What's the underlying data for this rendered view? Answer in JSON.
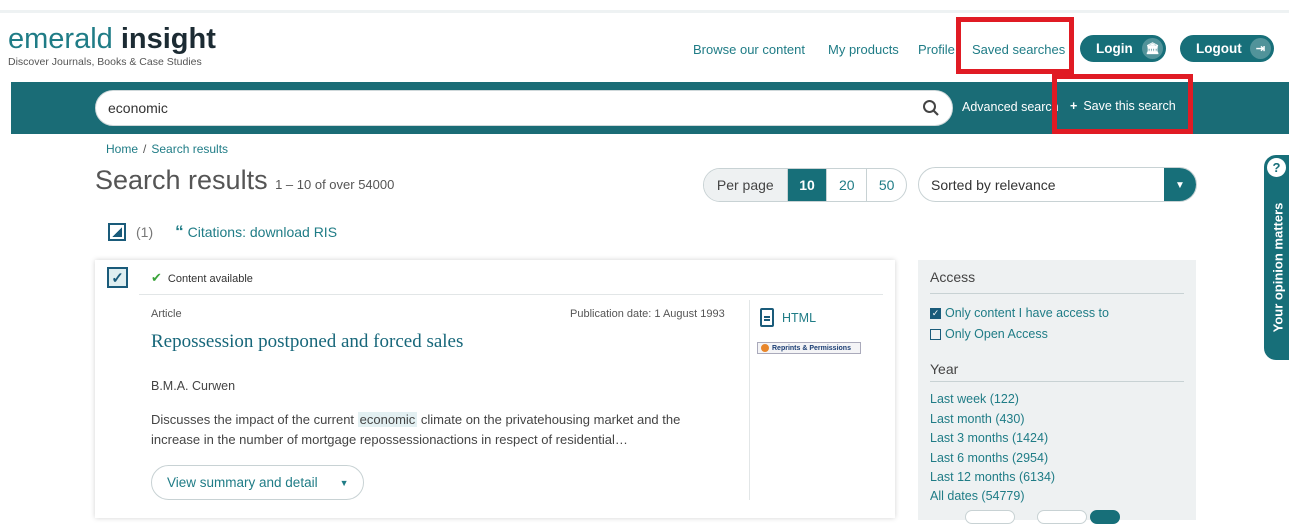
{
  "brand": {
    "name_part1": "emerald",
    "name_part2": "insight",
    "tagline": "Discover Journals, Books & Case Studies"
  },
  "nav": {
    "browse": "Browse our content",
    "products": "My products",
    "profile": "Profile",
    "saved": "Saved searches",
    "login": "Login",
    "logout": "Logout"
  },
  "search": {
    "value": "economic",
    "advanced": "Advanced search",
    "save": "Save this search"
  },
  "breadcrumb": {
    "home": "Home",
    "sep": "/",
    "current": "Search results"
  },
  "results": {
    "title": "Search results",
    "count": "1 – 10 of over 54000"
  },
  "per_page": {
    "label": "Per page",
    "options": [
      "10",
      "20",
      "50"
    ],
    "selected": "10"
  },
  "sort": {
    "value": "Sorted by relevance"
  },
  "selection": {
    "count": "(1)",
    "citations": "Citations: download RIS"
  },
  "result": {
    "availability": "Content available",
    "type": "Article",
    "pub_date": "Publication date: 1 August 1993",
    "title": "Repossession postponed and forced sales",
    "author": "B.M.A. Curwen",
    "abstract_pre": "Discusses the impact of the current ",
    "abstract_hl": "economic",
    "abstract_post": " climate on the privatehousing market and the increase in the number of mortgage repossessionactions in respect of residential…",
    "summary_btn": "View summary and detail",
    "html": "HTML",
    "reprints": "Reprints & Permissions"
  },
  "facets": {
    "access_title": "Access",
    "access_opts": [
      {
        "label": "Only content I have access to",
        "checked": true
      },
      {
        "label": "Only Open Access",
        "checked": false
      }
    ],
    "year_title": "Year",
    "years": [
      "Last week (122)",
      "Last month (430)",
      "Last 3 months (1424)",
      "Last 6 months (2954)",
      "Last 12 months (6134)",
      "All dates (54779)"
    ]
  },
  "feedback": {
    "label": "Your opinion matters",
    "icon": "?"
  },
  "colors": {
    "teal": "#176f79",
    "band": "#1a6c76",
    "highlight_red": "#e01b24",
    "link": "#1f7c86"
  }
}
